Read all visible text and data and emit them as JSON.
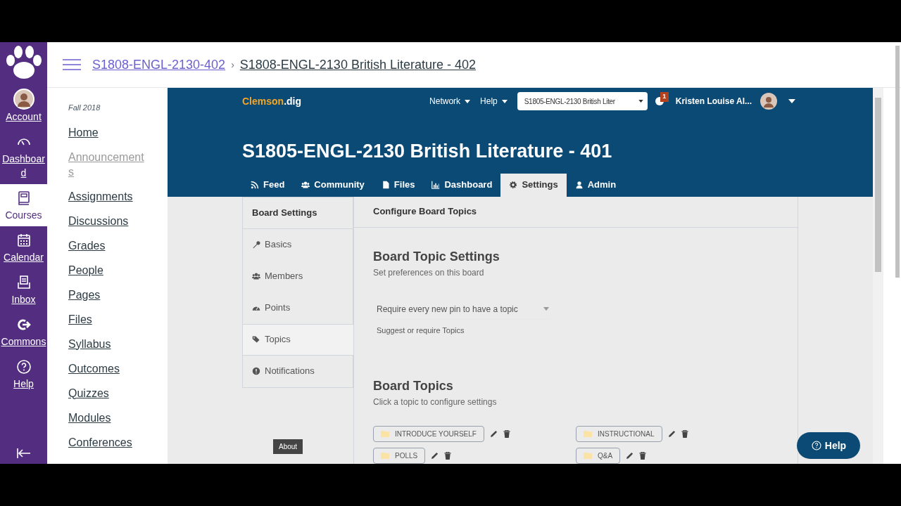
{
  "global_nav": [
    {
      "kind": "logo"
    },
    {
      "kind": "avatar",
      "label": "Account",
      "selected": false
    },
    {
      "kind": "dashboard",
      "label": "Dashboard",
      "selected": false
    },
    {
      "kind": "courses",
      "label": "Courses",
      "selected": true
    },
    {
      "kind": "calendar",
      "label": "Calendar",
      "selected": false
    },
    {
      "kind": "inbox",
      "label": "Inbox",
      "selected": false
    },
    {
      "kind": "commons",
      "label": "Commons",
      "selected": false
    },
    {
      "kind": "help",
      "label": "Help",
      "selected": false
    }
  ],
  "breadcrumbs": [
    "S1808-ENGL-2130-402",
    "S1808-ENGL-2130 British Literature - 402"
  ],
  "breadcrumb_separator": "›",
  "course_nav": {
    "term": "Fall 2018",
    "items": [
      {
        "label": "Home",
        "disabled": false
      },
      {
        "label": "Announcements",
        "disabled": true
      },
      {
        "label": "Assignments",
        "disabled": false
      },
      {
        "label": "Discussions",
        "disabled": false
      },
      {
        "label": "Grades",
        "disabled": false
      },
      {
        "label": "People",
        "disabled": false
      },
      {
        "label": "Pages",
        "disabled": false
      },
      {
        "label": "Files",
        "disabled": false
      },
      {
        "label": "Syllabus",
        "disabled": false
      },
      {
        "label": "Outcomes",
        "disabled": false
      },
      {
        "label": "Quizzes",
        "disabled": false
      },
      {
        "label": "Modules",
        "disabled": false
      },
      {
        "label": "Conferences",
        "disabled": false
      }
    ]
  },
  "app": {
    "logo": [
      "Clemson",
      ".dig"
    ],
    "menus": [
      "Network",
      "Help"
    ],
    "course_select": "S1805-ENGL-2130 British Liter",
    "notification_count": "1",
    "user": "Kristen Louise Al...",
    "title": "S1805-ENGL-2130 British Literature - 401",
    "tabs": [
      {
        "kind": "rss",
        "label": "Feed",
        "selected": false
      },
      {
        "kind": "users",
        "label": "Community",
        "selected": false
      },
      {
        "kind": "file",
        "label": "Files",
        "selected": false
      },
      {
        "kind": "chart",
        "label": "Dashboard",
        "selected": false
      },
      {
        "kind": "gear",
        "label": "Settings",
        "selected": true
      },
      {
        "kind": "user",
        "label": "Admin",
        "selected": false
      }
    ]
  },
  "board_settings": {
    "title": "Board Settings",
    "items": [
      {
        "kind": "wrench",
        "label": "Basics",
        "selected": false
      },
      {
        "kind": "users",
        "label": "Members",
        "selected": false
      },
      {
        "kind": "gauge",
        "label": "Points",
        "selected": false
      },
      {
        "kind": "tags",
        "label": "Topics",
        "selected": true
      },
      {
        "kind": "alert",
        "label": "Notifications",
        "selected": false
      }
    ],
    "about": "About"
  },
  "panel": {
    "title": "Configure Board Topics",
    "settings_title": "Board Topic Settings",
    "settings_subtitle": "Set preferences on this board",
    "topic_select": "Require every new pin to have a topic",
    "topic_select_hint": "Suggest or require Topics",
    "topics_title": "Board Topics",
    "topics_subtitle": "Click a topic to configure settings",
    "topics": [
      "INTRODUCE YOURSELF",
      "INSTRUCTIONAL",
      "POLLS",
      "Q&A"
    ]
  },
  "help_button": "Help"
}
